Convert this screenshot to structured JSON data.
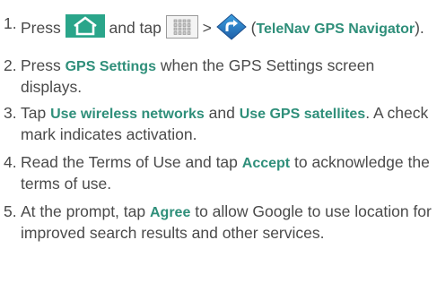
{
  "steps": [
    {
      "number": "1.",
      "parts": {
        "a": "Press",
        "b": "and tap",
        "c": ">",
        "d": "(",
        "e": "TeleNav GPS Navigator",
        "f": ")."
      },
      "icons": [
        "home-icon",
        "apps-grid-icon",
        "telenav-navigator-icon"
      ]
    },
    {
      "number": "2.",
      "parts": {
        "a": "Press",
        "b": "GPS Settings",
        "c": "when the GPS Settings screen displays."
      }
    },
    {
      "number": "3.",
      "parts": {
        "a": "Tap",
        "b": "Use wireless networks",
        "c": "and",
        "d": "Use GPS satellites",
        "e": ". A check mark indicates activation."
      }
    },
    {
      "number": "4.",
      "parts": {
        "a": "Read the Terms of Use and tap",
        "b": "Accept",
        "c": "to acknowledge the terms of use."
      }
    },
    {
      "number": "5.",
      "parts": {
        "a": "At the prompt, tap",
        "b": "Agree",
        "c": "to allow Google to use location for improved search results and other services."
      }
    }
  ],
  "colors": {
    "text": "#4a4a4a",
    "highlight": "#2f8f7a",
    "icon_fill": "#2aa58a",
    "nav_icon": "#2b7fc4"
  }
}
